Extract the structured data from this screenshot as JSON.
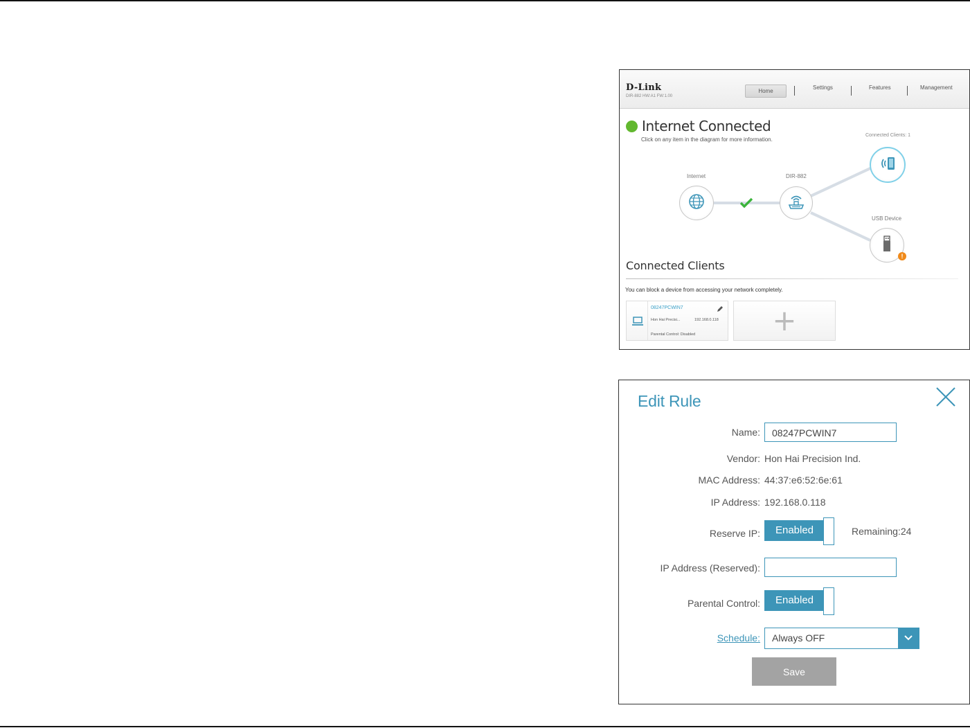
{
  "router": {
    "brand": "D-Link",
    "firmware": "DIR-882 HW:A1 FW:1.00",
    "nav": [
      "Home",
      "Settings",
      "Features",
      "Management"
    ],
    "status_title": "Internet Connected",
    "status_hint": "Click on any item in the diagram for more information.",
    "connected_clients_count": "Connected Clients: 1",
    "diagram": {
      "internet_label": "Internet",
      "router_label": "DIR-882",
      "usb_label": "USB Device"
    },
    "clients_title": "Connected Clients",
    "clients_hint": "You can block a device from accessing your network completely.",
    "client": {
      "name": "08247PCWIN7",
      "vendor": "Hon Hai Precisi...",
      "ip": "192.168.0.118",
      "parental": "Parental Control: Disabled"
    },
    "add_symbol": "+"
  },
  "edit_rule": {
    "title": "Edit Rule",
    "name_label": "Name:",
    "name_value": "08247PCWIN7",
    "vendor_label": "Vendor:",
    "vendor_value": "Hon Hai Precision Ind.",
    "mac_label": "MAC Address:",
    "mac_value": "44:37:e6:52:6e:61",
    "ip_label": "IP Address:",
    "ip_value": "192.168.0.118",
    "reserve_label": "Reserve IP:",
    "reserve_toggle": "Enabled",
    "remaining": "Remaining:24",
    "reserved_label": "IP Address (Reserved):",
    "reserved_value": "",
    "parental_label": "Parental Control:",
    "parental_toggle": "Enabled",
    "schedule_label": "Schedule:",
    "schedule_value": "Always OFF",
    "save_label": "Save"
  },
  "colors": {
    "accent": "#3d95b8",
    "status_green": "#62b82f",
    "warning": "#f08a1a",
    "button_gray": "#a3a3a3"
  }
}
